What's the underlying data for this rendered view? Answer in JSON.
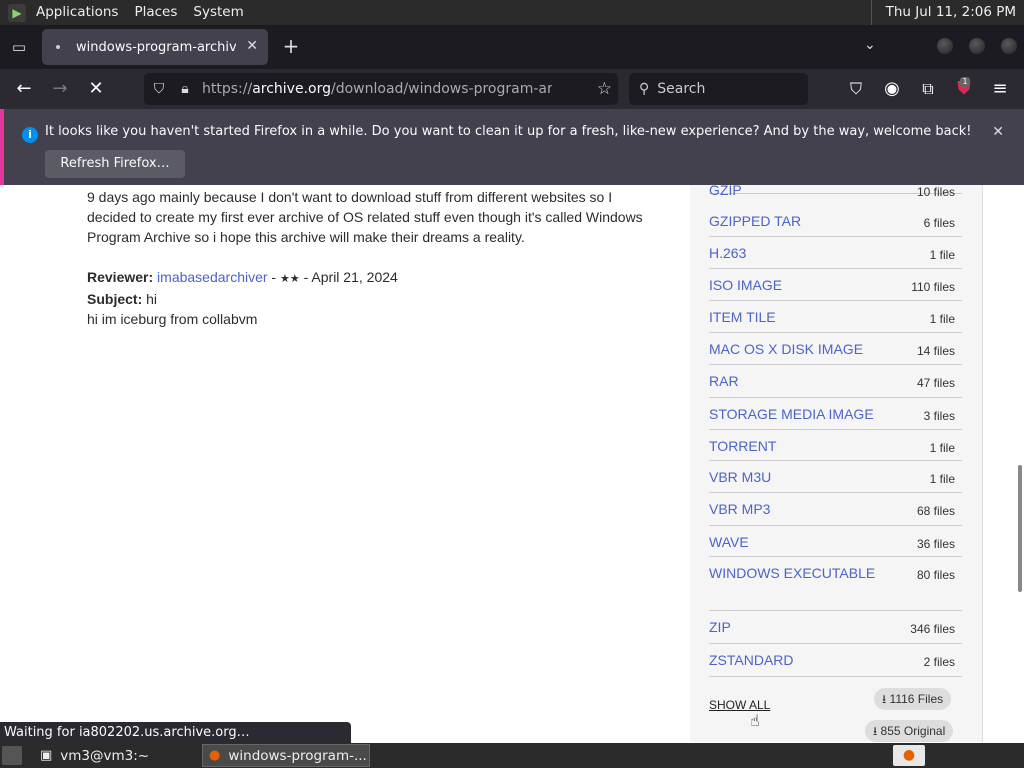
{
  "top_panel": {
    "menus": [
      "Applications",
      "Places",
      "System"
    ],
    "clock": "Thu Jul 11,  2:06 PM"
  },
  "tab": {
    "title": "windows-program-archive"
  },
  "nav": {
    "url_prefix": "https://",
    "url_host": "archive.org",
    "url_path": "/download/windows-program-archive",
    "search_placeholder": "Search",
    "ext_badge": "1"
  },
  "notification": {
    "message": "It looks like you haven't started Firefox in a while. Do you want to clean it up for a fresh, like-new experience? And by the way, welcome back!",
    "button": "Refresh Firefox…"
  },
  "review": {
    "body": "9 days ago mainly because I don't want to download stuff from different websites so I decided to create my first ever archive of OS related stuff even though it's called Windows Program Archive so i hope this archive will make their dreams a reality.",
    "reviewer_label": "Reviewer:",
    "reviewer_name": "imabasedarchiver",
    "rating_stars": "★★",
    "sep": " - ",
    "date": "April 21, 2024",
    "subject_label": "Subject:",
    "subject": "hi",
    "text": "hi im iceburg from collabvm"
  },
  "formats": [
    {
      "name": "GZIP",
      "count": "10 files"
    },
    {
      "name": "GZIPPED TAR",
      "count": "6 files"
    },
    {
      "name": "H.263",
      "count": "1 file"
    },
    {
      "name": "ISO IMAGE",
      "count": "110 files"
    },
    {
      "name": "ITEM TILE",
      "count": "1 file"
    },
    {
      "name": "MAC OS X DISK IMAGE",
      "count": "14 files"
    },
    {
      "name": "RAR",
      "count": "47 files"
    },
    {
      "name": "STORAGE MEDIA IMAGE",
      "count": "3 files"
    },
    {
      "name": "TORRENT",
      "count": "1 file"
    },
    {
      "name": "VBR M3U",
      "count": "1 file"
    },
    {
      "name": "VBR MP3",
      "count": "68 files"
    },
    {
      "name": "WAVE",
      "count": "36 files"
    },
    {
      "name": "WINDOWS EXECUTABLE",
      "count": "80 files"
    },
    {
      "name": "ZIP",
      "count": "346 files"
    },
    {
      "name": "ZSTANDARD",
      "count": "2 files"
    }
  ],
  "show_all": "SHOW ALL",
  "download_files": "1116 Files",
  "download_original": "855 Original",
  "status": "Waiting for ia802202.us.archive.org…",
  "taskbar": {
    "terminal": "vm3@vm3:~",
    "firefox": "windows-program-..."
  }
}
